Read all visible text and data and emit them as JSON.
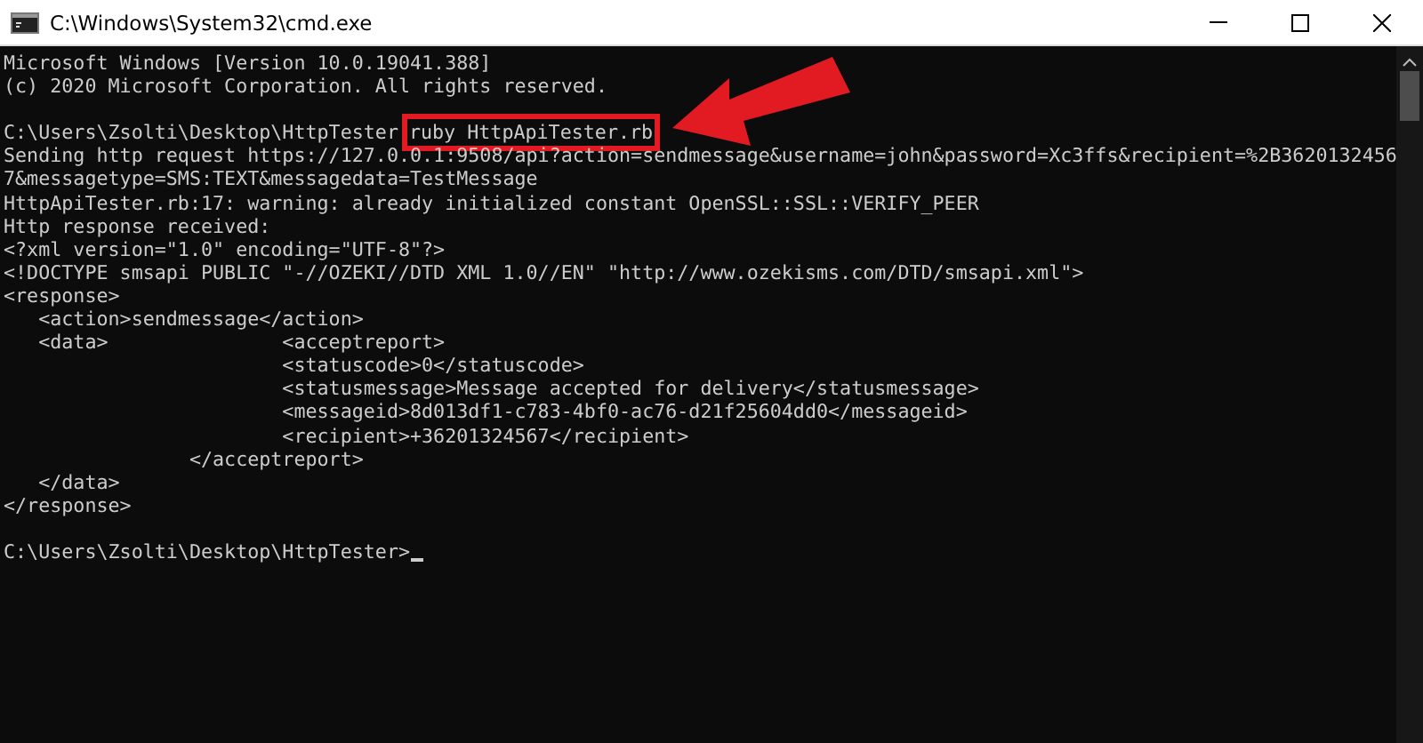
{
  "window": {
    "title": "C:\\Windows\\System32\\cmd.exe"
  },
  "console": {
    "lines": [
      {
        "kind": "text",
        "text": "Microsoft Windows [Version 10.0.19041.388]"
      },
      {
        "kind": "text",
        "text": "(c) 2020 Microsoft Corporation. All rights reserved."
      },
      {
        "kind": "blank"
      },
      {
        "kind": "command",
        "prompt": "C:\\Users\\Zsolti\\Desktop\\HttpTester",
        "text": "ruby HttpApiTester.rb",
        "highlighted": true
      },
      {
        "kind": "text",
        "text": "Sending http request https://127.0.0.1:9508/api?action=sendmessage&username=john&password=Xc3ffs&recipient=%2B3620132456"
      },
      {
        "kind": "text",
        "text": "7&messagetype=SMS:TEXT&messagedata=TestMessage"
      },
      {
        "kind": "text",
        "text": "HttpApiTester.rb:17: warning: already initialized constant OpenSSL::SSL::VERIFY_PEER"
      },
      {
        "kind": "text",
        "text": "Http response received:"
      },
      {
        "kind": "text",
        "text": "<?xml version=\"1.0\" encoding=\"UTF-8\"?>"
      },
      {
        "kind": "text",
        "text": "<!DOCTYPE smsapi PUBLIC \"-//OZEKI//DTD XML 1.0//EN\" \"http://www.ozekisms.com/DTD/smsapi.xml\">"
      },
      {
        "kind": "text",
        "text": "<response>"
      },
      {
        "kind": "text",
        "text": "   <action>sendmessage</action>"
      },
      {
        "kind": "text",
        "text": "   <data>               <acceptreport>"
      },
      {
        "kind": "text",
        "text": "                        <statuscode>0</statuscode>"
      },
      {
        "kind": "text",
        "text": "                        <statusmessage>Message accepted for delivery</statusmessage>"
      },
      {
        "kind": "text",
        "text": "                        <messageid>8d013df1-c783-4bf0-ac76-d21f25604dd0</messageid>"
      },
      {
        "kind": "text",
        "text": "                        <recipient>+36201324567</recipient>"
      },
      {
        "kind": "text",
        "text": "                </acceptreport>"
      },
      {
        "kind": "text",
        "text": "   </data>"
      },
      {
        "kind": "text",
        "text": "</response>"
      },
      {
        "kind": "blank"
      },
      {
        "kind": "prompt",
        "text": "C:\\Users\\Zsolti\\Desktop\\HttpTester>",
        "cursor": true
      }
    ]
  }
}
